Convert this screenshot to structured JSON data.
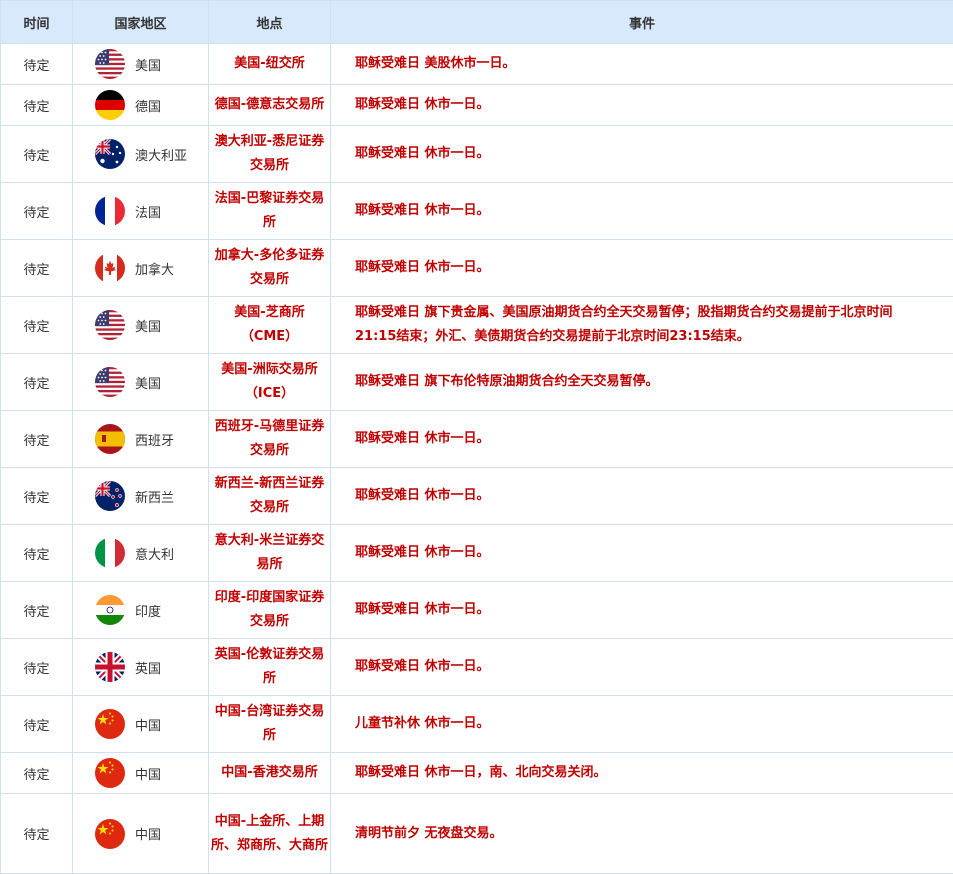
{
  "headers": {
    "time": "时间",
    "country": "国家地区",
    "place": "地点",
    "event": "事件"
  },
  "rows": [
    {
      "time": "待定",
      "flag": "us-flag",
      "country": "美国",
      "place": "美国-纽交所",
      "event": "耶稣受难日 美股休市一日。"
    },
    {
      "time": "待定",
      "flag": "de-flag",
      "country": "德国",
      "place": "德国-德意志交易所",
      "event": "耶稣受难日 休市一日。"
    },
    {
      "time": "待定",
      "flag": "au-flag",
      "country": "澳大利亚",
      "place": "澳大利亚-悉尼证券交易所",
      "event": "耶稣受难日 休市一日。"
    },
    {
      "time": "待定",
      "flag": "fr-flag",
      "country": "法国",
      "place": "法国-巴黎证券交易所",
      "event": "耶稣受难日 休市一日。"
    },
    {
      "time": "待定",
      "flag": "ca-flag",
      "country": "加拿大",
      "place": "加拿大-多伦多证券交易所",
      "event": "耶稣受难日 休市一日。"
    },
    {
      "time": "待定",
      "flag": "us-flag",
      "country": "美国",
      "place": "美国-芝商所（CME）",
      "event": "耶稣受难日 旗下贵金属、美国原油期货合约全天交易暂停；股指期货合约交易提前于北京时间21:15结束；外汇、美债期货合约交易提前于北京时间23:15结束。"
    },
    {
      "time": "待定",
      "flag": "us-flag",
      "country": "美国",
      "place": "美国-洲际交易所（ICE）",
      "event": "耶稣受难日 旗下布伦特原油期货合约全天交易暂停。"
    },
    {
      "time": "待定",
      "flag": "es-flag",
      "country": "西班牙",
      "place": "西班牙-马德里证券交易所",
      "event": "耶稣受难日 休市一日。"
    },
    {
      "time": "待定",
      "flag": "nz-flag",
      "country": "新西兰",
      "place": "新西兰-新西兰证券交易所",
      "event": "耶稣受难日 休市一日。"
    },
    {
      "time": "待定",
      "flag": "it-flag",
      "country": "意大利",
      "place": "意大利-米兰证券交易所",
      "event": "耶稣受难日 休市一日。"
    },
    {
      "time": "待定",
      "flag": "in-flag",
      "country": "印度",
      "place": "印度-印度国家证券交易所",
      "event": "耶稣受难日 休市一日。"
    },
    {
      "time": "待定",
      "flag": "uk-flag",
      "country": "英国",
      "place": "英国-伦敦证券交易所",
      "event": "耶稣受难日 休市一日。"
    },
    {
      "time": "待定",
      "flag": "cn-flag",
      "country": "中国",
      "place": "中国-台湾证券交易所",
      "event": "儿童节补休 休市一日。"
    },
    {
      "time": "待定",
      "flag": "cn-flag",
      "country": "中国",
      "place": "中国-香港交易所",
      "event": "耶稣受难日 休市一日，南、北向交易关闭。"
    },
    {
      "time": "待定",
      "flag": "cn-flag",
      "country": "中国",
      "place": "中国-上金所、上期所、郑商所、大商所",
      "event": "清明节前夕 无夜盘交易。"
    }
  ]
}
